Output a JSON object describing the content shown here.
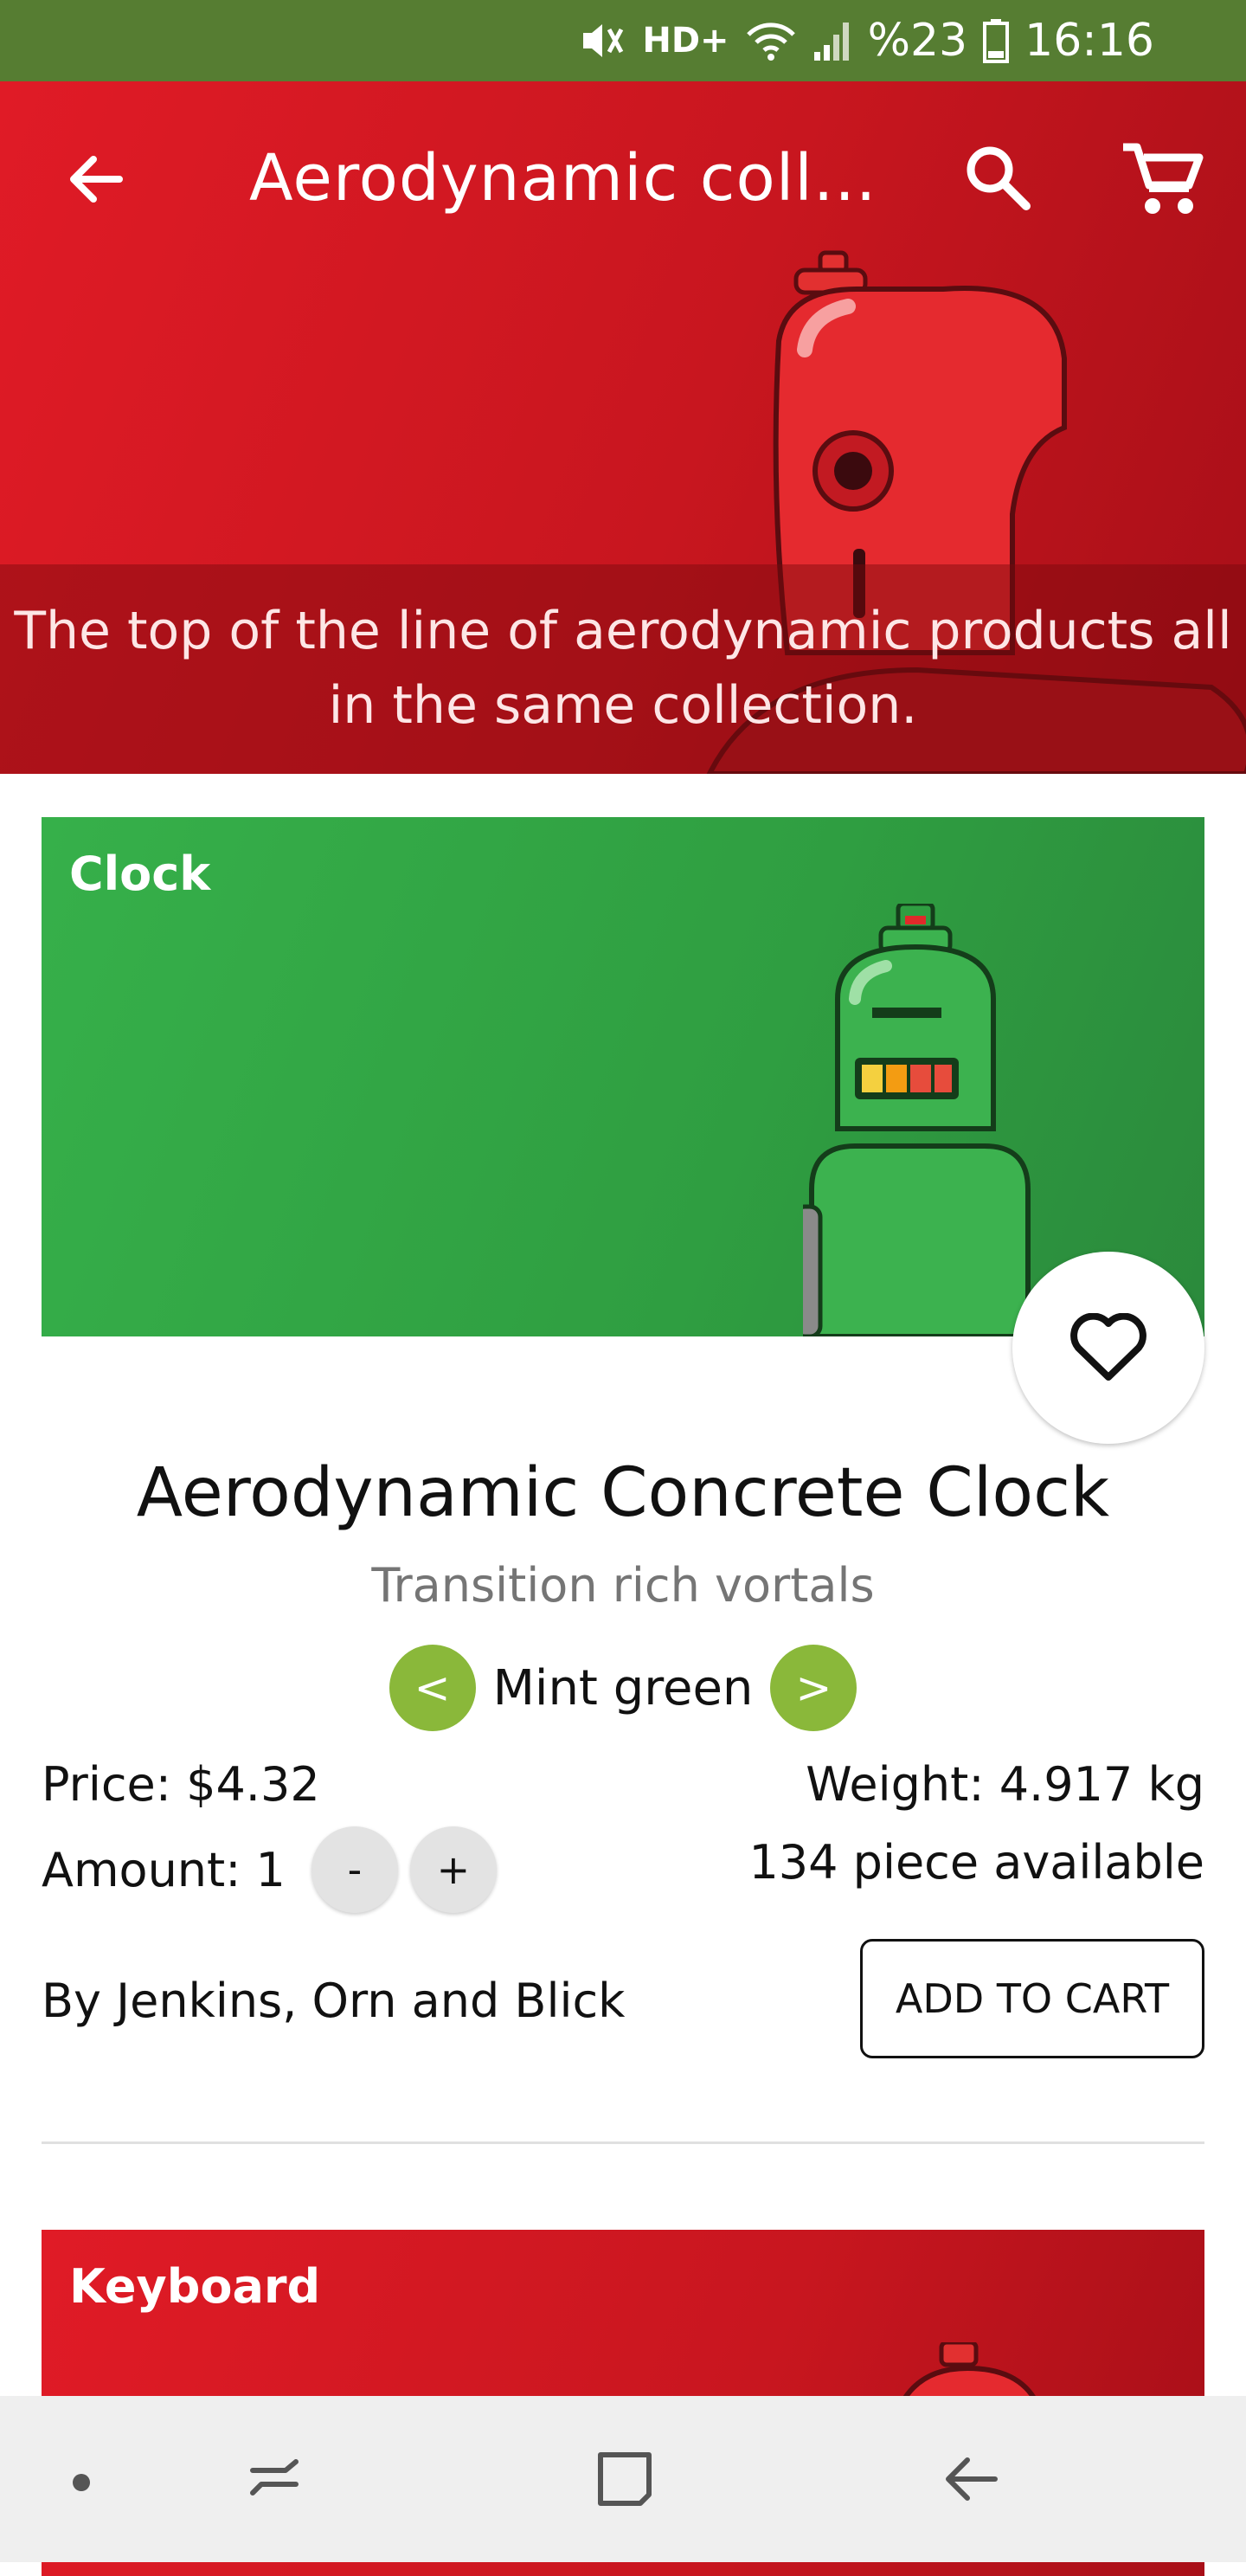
{
  "status_bar": {
    "network": "HD+",
    "battery": "%23",
    "time": "16:16"
  },
  "app_bar": {
    "title": "Aerodynamic coll...",
    "icons": [
      "back-arrow-icon",
      "search-icon",
      "cart-icon"
    ]
  },
  "collection": {
    "description": "The top of the line of aerodynamic products all in the same collection."
  },
  "product": {
    "category": "Clock",
    "name": "Aerodynamic Concrete Clock",
    "tagline": "Transition rich vortals",
    "variant": {
      "prev_label": "<",
      "name": "Mint green",
      "next_label": ">"
    },
    "price_label": "Price: $4.32",
    "amount_label": "Amount: 1",
    "decrease_label": "-",
    "increase_label": "+",
    "weight_label": "Weight: 4.917 kg",
    "stock_label": "134 piece available",
    "maker_label": "By Jenkins, Orn and Blick",
    "add_to_cart_label": "ADD TO CART",
    "banner_color": "#36b04a"
  },
  "next_product": {
    "category": "Keyboard",
    "banner_color": "#e01b26"
  },
  "colors": {
    "status_bar": "#567d32",
    "header_red": "#e01b26",
    "accent_green": "#8ab83a"
  }
}
